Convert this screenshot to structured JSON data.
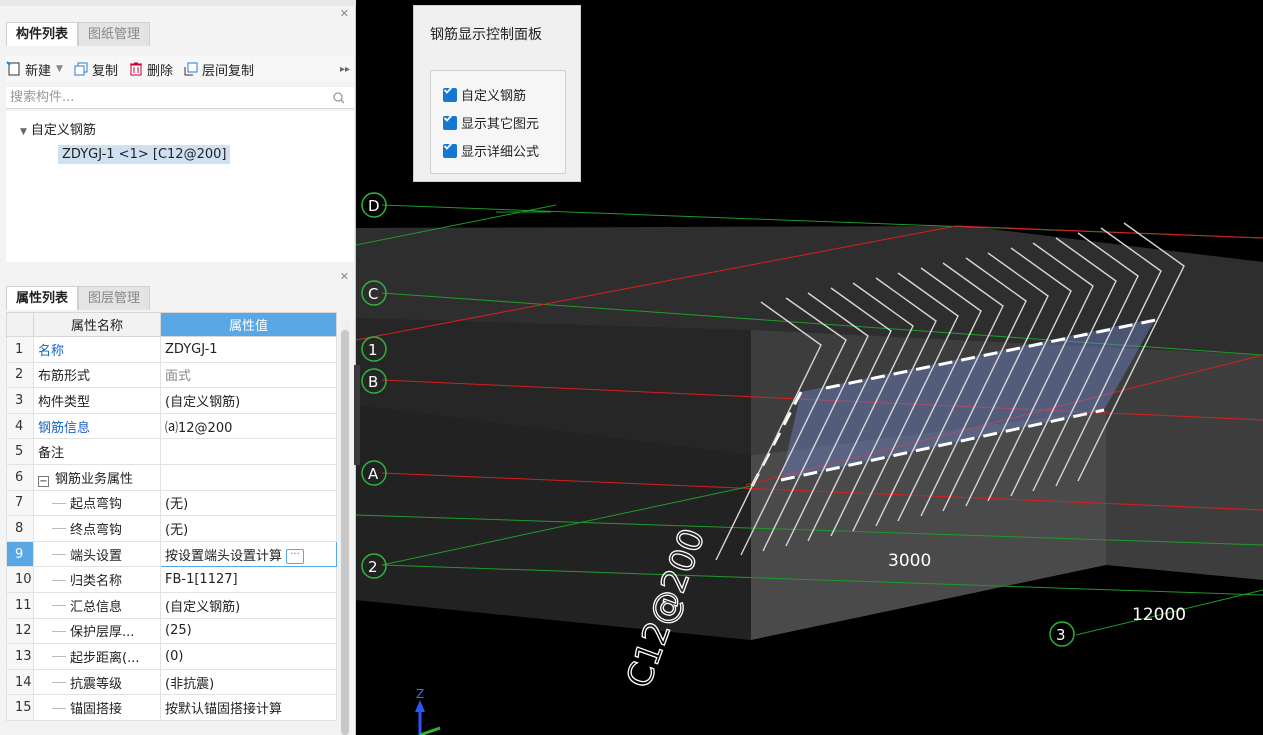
{
  "component_panel": {
    "tabs": [
      {
        "label": "构件列表"
      },
      {
        "label": "图纸管理"
      }
    ],
    "toolbar": {
      "new": "新建",
      "copy": "复制",
      "delete": "删除",
      "layer_copy": "层间复制"
    },
    "search_placeholder": "搜索构件...",
    "tree": {
      "root": "自定义钢筋",
      "child": "ZDYGJ-1 <1> [C12@200]"
    }
  },
  "property_panel": {
    "tabs": [
      {
        "label": "属性列表"
      },
      {
        "label": "图层管理"
      }
    ],
    "headers": {
      "name": "属性名称",
      "value": "属性值"
    },
    "rows": [
      {
        "num": "1",
        "name": "名称",
        "value": "ZDYGJ-1"
      },
      {
        "num": "2",
        "name": "布筋形式",
        "value": "面式"
      },
      {
        "num": "3",
        "name": "构件类型",
        "value": "(自定义钢筋)"
      },
      {
        "num": "4",
        "name": "钢筋信息",
        "value": "⒜12@200"
      },
      {
        "num": "5",
        "name": "备注",
        "value": ""
      },
      {
        "num": "6",
        "name": "钢筋业务属性",
        "value": ""
      },
      {
        "num": "7",
        "name": "起点弯钩",
        "value": "(无)"
      },
      {
        "num": "8",
        "name": "终点弯钩",
        "value": "(无)"
      },
      {
        "num": "9",
        "name": "端头设置",
        "value": "按设置端头设置计算"
      },
      {
        "num": "10",
        "name": "归类名称",
        "value": "FB-1[1127]"
      },
      {
        "num": "11",
        "name": "汇总信息",
        "value": "(自定义钢筋)"
      },
      {
        "num": "12",
        "name": "保护层厚...",
        "value": "(25)"
      },
      {
        "num": "13",
        "name": "起步距离(...",
        "value": "(0)"
      },
      {
        "num": "14",
        "name": "抗震等级",
        "value": "(非抗震)"
      },
      {
        "num": "15",
        "name": "锚固搭接",
        "value": "按默认锚固搭接计算"
      }
    ]
  },
  "control_panel": {
    "title": "钢筋显示控制面板",
    "options": [
      {
        "label": "自定义钢筋",
        "checked": true
      },
      {
        "label": "显示其它图元",
        "checked": true
      },
      {
        "label": "显示详细公式",
        "checked": true
      }
    ]
  },
  "viewport": {
    "axes": [
      {
        "label": "D"
      },
      {
        "label": "C"
      },
      {
        "label": "1"
      },
      {
        "label": "B"
      },
      {
        "label": "A"
      },
      {
        "label": "2"
      },
      {
        "label": "3"
      }
    ],
    "dimensions": [
      {
        "text": "3000"
      },
      {
        "text": "12000"
      }
    ],
    "rebar_label": "C12@200",
    "axis_z": "Z",
    "colors": {
      "red_line": "#d81e1e",
      "green_line": "#1f9a2a",
      "axis_circle": "#2bb53a",
      "selection": "#6f86c8"
    }
  }
}
